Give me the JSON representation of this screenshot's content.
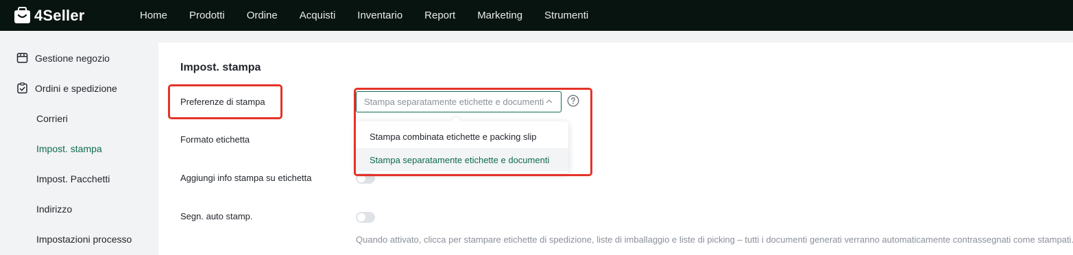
{
  "brand": {
    "name": "4Seller"
  },
  "nav": [
    "Home",
    "Prodotti",
    "Ordine",
    "Acquisti",
    "Inventario",
    "Report",
    "Marketing",
    "Strumenti"
  ],
  "sidebar": {
    "groups": [
      {
        "label": "Gestione negozio",
        "icon": "store-icon"
      },
      {
        "label": "Ordini e spedizione",
        "icon": "clipboard-icon"
      }
    ],
    "items": [
      "Corrieri",
      "Impost. stampa",
      "Impost. Pacchetti",
      "Indirizzo",
      "Impostazioni processo"
    ],
    "active": "Impost. stampa"
  },
  "main": {
    "title": "Impost. stampa",
    "rows": {
      "print_pref": "Preferenze di stampa",
      "label_format": "Formato etichetta",
      "add_info": "Aggiungi info stampa su etichetta",
      "auto_mark": "Segn. auto stamp."
    },
    "select": {
      "value": "Stampa separatamente etichette e documenti"
    },
    "dropdown": {
      "options": [
        "Stampa combinata etichette e packing slip",
        "Stampa separatamente etichette e documenti"
      ],
      "selected_index": 1
    },
    "toggles": {
      "add_info": false,
      "auto_mark": false
    },
    "hint": "Quando attivato, clicca per stampare etichette di spedizione, liste di imballaggio e liste di picking – tutti i documenti generati verranno automaticamente contrassegnati come stampati."
  },
  "colors": {
    "topbar": "#08140f",
    "accent": "#0f6b4f",
    "highlight": "#e53228"
  }
}
